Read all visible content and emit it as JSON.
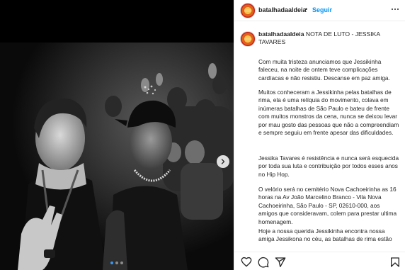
{
  "post": {
    "username": "batalhadaaldeia",
    "separator": "•",
    "follow_label": "Seguir"
  },
  "caption": {
    "username": "batalhadaaldeia",
    "title": "NOTA DE LUTO - JESSIKA TAVARES",
    "paragraphs": [
      "Com muita tristeza anunciamos que Jessikinha faleceu, na noite de ontem teve complicações cardíacas e não resistiu. Descanse em paz amiga.",
      "Muitos conheceram a Jessikinha pelas batalhas de rima, ela é uma relíquia do movimento, colava em inúmeras batalhas de São Paulo e bateu de frente com muitos monstros da cena, nunca se deixou levar por mau gosto das pessoas que não a compreendiam e sempre seguiu em frente apesar das dificuldades.",
      "Jessika Tavares é resistência e nunca será esquecida por toda sua luta e contribuição por todos esses anos no Hip Hop.",
      "O velório será no cemitério Nova Cachoeirinha as 16 horas na Av João Marcelino Branco - Vila Nova Cachoeirinha, São Paulo - SP, 02610-000, aos amigos que consideravam, colem para prestar ultima homenagem.",
      "Hoje a nossa querida Jessikinha encontra nossa amiga Jessikona no céu, as batalhas de rima estão"
    ]
  },
  "media": {
    "slide_count": 3,
    "active_slide": 1
  },
  "icons": {
    "like": "heart-icon",
    "comment": "comment-icon",
    "share": "share-icon",
    "save": "bookmark-icon",
    "next": "chevron-right-icon",
    "more": "more-options-icon"
  },
  "colors": {
    "follow": "#0095f6",
    "text": "#262626",
    "border": "#efefef"
  }
}
